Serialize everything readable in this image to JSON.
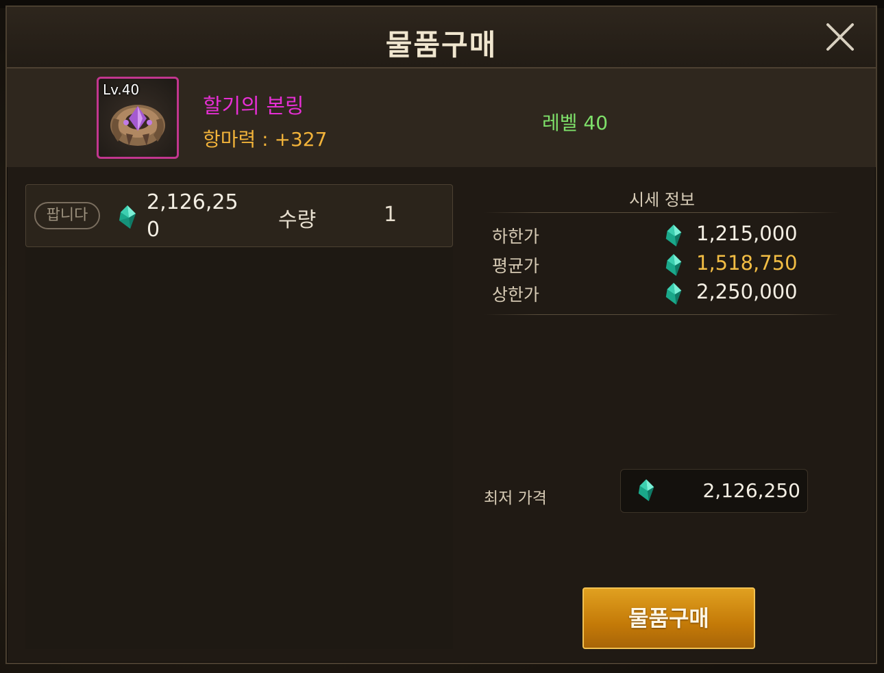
{
  "dialog": {
    "title": "물품구매"
  },
  "item": {
    "level_badge": "Lv.40",
    "name": "할기의 본링",
    "stat": "항마력 : +327",
    "required_level": "레벨 40",
    "icon": "claw-ring-icon",
    "rarity_color": "#c2368f"
  },
  "listing": {
    "badge": "팝니다",
    "price": "2,126,250",
    "quantity_label": "수량",
    "quantity": "1",
    "currency_icon": "gem-icon"
  },
  "market_price": {
    "title": "시세 정보",
    "rows": [
      {
        "label": "하한가",
        "value": "1,215,000",
        "color": "#f4efe4"
      },
      {
        "label": "평균가",
        "value": "1,518,750",
        "color": "#f2bd44"
      },
      {
        "label": "상한가",
        "value": "2,250,000",
        "color": "#f4efe4"
      }
    ]
  },
  "lowest_price": {
    "label": "최저 가격",
    "value": "2,126,250"
  },
  "buy_button": {
    "label": "물품구매"
  },
  "colors": {
    "accent": "#e0a020",
    "item_name": "#e62fd4",
    "stat": "#f2b33a",
    "level": "#7ee06a"
  }
}
